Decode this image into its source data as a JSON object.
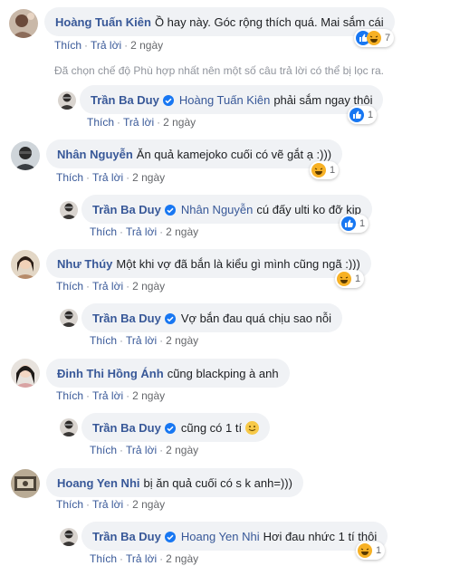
{
  "actions": {
    "like": "Thích",
    "reply": "Trả lời",
    "time": "2 ngày"
  },
  "notice": "Đã chọn chế độ Phù hợp nhất nên một số câu trả lời có thể bị lọc ra.",
  "colors": {
    "link": "#385898",
    "bubble": "#f0f2f5",
    "like": "#1877f2",
    "haha": "#f7b125"
  },
  "comments": [
    {
      "author": "Hoàng Tuấn Kiên",
      "text": "Ồ hay này. Góc rộng thích quá. Mai sắm cái",
      "reactions": [
        "like-icon",
        "haha-icon"
      ],
      "count": "7"
    },
    {
      "author": "Trần Ba Duy",
      "tag": "Hoàng Tuấn Kiên",
      "text": "phải sắm ngay thôi",
      "reactions": [
        "like-icon"
      ],
      "count": "1"
    },
    {
      "author": "Nhân Nguyễn",
      "text": "Ăn quả kamejoko cuối có vẽ gắt ạ :)))",
      "reactions": [
        "haha-icon"
      ],
      "count": "1"
    },
    {
      "author": "Trần Ba Duy",
      "tag": "Nhân Nguyễn",
      "text": "cú đấy ulti ko đỡ kịp",
      "reactions": [
        "like-icon"
      ],
      "count": "1"
    },
    {
      "author": "Như Thúy",
      "text": "Một khi vợ đã bắn là kiểu gì mình cũng ngã :)))",
      "reactions": [
        "haha-icon"
      ],
      "count": "1"
    },
    {
      "author": "Trần Ba Duy",
      "text": "Vợ bắn đau quá chịu sao nỗi"
    },
    {
      "author": "Đinh Thi Hồng Ánh",
      "text": "cũng blackping à anh"
    },
    {
      "author": "Trần Ba Duy",
      "text": "cũng có 1 tí",
      "emoji": "smile-emoji"
    },
    {
      "author": "Hoang Yen Nhi",
      "text": "bị ăn quả cuối có s k anh=)))"
    },
    {
      "author": "Trần Ba Duy",
      "tag": "Hoang Yen Nhi",
      "text": "Hơi đau nhức 1 tí thôi",
      "reactions": [
        "haha-icon"
      ],
      "count": "1"
    }
  ]
}
